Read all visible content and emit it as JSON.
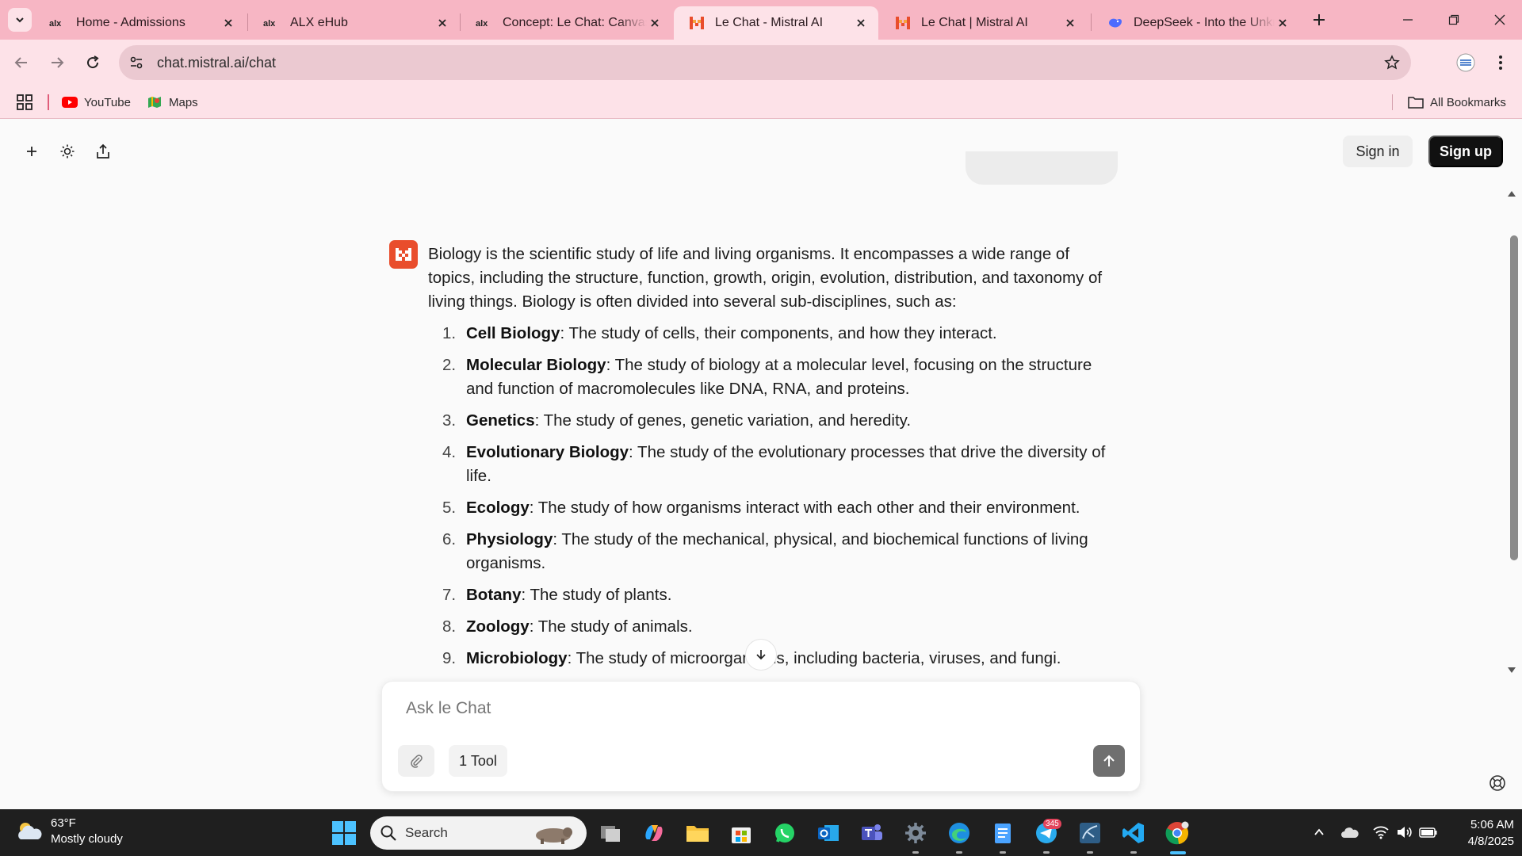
{
  "browser": {
    "tabs": [
      {
        "title": "Home - Admissions",
        "favicon": "alx-logo-icon",
        "active": false
      },
      {
        "title": "ALX eHub",
        "favicon": "alx-logo-icon",
        "active": false
      },
      {
        "title": "Concept: Le Chat: Canvas a",
        "favicon": "alx-logo-icon",
        "active": false
      },
      {
        "title": "Le Chat - Mistral AI",
        "favicon": "mistral-logo-icon",
        "active": true
      },
      {
        "title": "Le Chat | Mistral AI",
        "favicon": "mistral-logo-icon",
        "active": false
      },
      {
        "title": "DeepSeek - Into the Unkno",
        "favicon": "deepseek-logo-icon",
        "active": false
      }
    ],
    "url": "chat.mistral.ai/chat",
    "bookmarks": [
      {
        "label": "YouTube",
        "icon": "youtube-icon"
      },
      {
        "label": "Maps",
        "icon": "maps-icon"
      }
    ],
    "all_bookmarks_label": "All Bookmarks"
  },
  "header": {
    "sign_in": "Sign in",
    "sign_up": "Sign up"
  },
  "message": {
    "intro": "Biology is the scientific study of life and living organisms. It encompasses a wide range of topics, including the structure, function, growth, origin, evolution, distribution, and taxonomy of living things. Biology is often divided into several sub-disciplines, such as:",
    "items": [
      {
        "num": "1.",
        "term": "Cell Biology",
        "desc": ": The study of cells, their components, and how they interact."
      },
      {
        "num": "2.",
        "term": "Molecular Biology",
        "desc": ": The study of biology at a molecular level, focusing on the structure and function of macromolecules like DNA, RNA, and proteins."
      },
      {
        "num": "3.",
        "term": "Genetics",
        "desc": ": The study of genes, genetic variation, and heredity."
      },
      {
        "num": "4.",
        "term": "Evolutionary Biology",
        "desc": ": The study of the evolutionary processes that drive the diversity of life."
      },
      {
        "num": "5.",
        "term": "Ecology",
        "desc": ": The study of how organisms interact with each other and their environment."
      },
      {
        "num": "6.",
        "term": "Physiology",
        "desc": ": The study of the mechanical, physical, and biochemical functions of living organisms."
      },
      {
        "num": "7.",
        "term": "Botany",
        "desc": ": The study of plants."
      },
      {
        "num": "8.",
        "term": "Zoology",
        "desc": ": The study of animals."
      },
      {
        "num": "9.",
        "term": "Microbiology",
        "desc": ": The study of microorganisms, including bacteria, viruses, and fungi."
      }
    ]
  },
  "composer": {
    "placeholder": "Ask le Chat",
    "tool_label": "1 Tool"
  },
  "taskbar": {
    "weather_temp": "63°F",
    "weather_desc": "Mostly cloudy",
    "search_label": "Search",
    "telegram_badge": "345",
    "time": "5:06 AM",
    "date": "4/8/2025"
  },
  "colors": {
    "tab_bar": "#f7b6c4",
    "toolbar": "#fde2e8",
    "mistral_orange": "#e94d2c",
    "sign_up_bg": "#111111"
  }
}
